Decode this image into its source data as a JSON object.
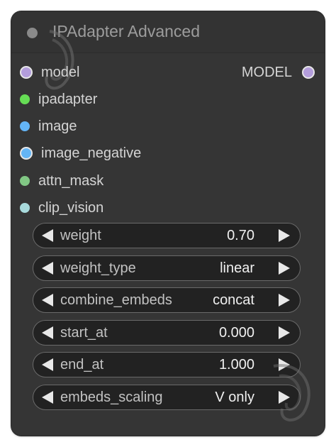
{
  "node": {
    "title": "IPAdapter Advanced",
    "inputs": [
      {
        "label": "model",
        "color": "#b39ddb",
        "ring": true
      },
      {
        "label": "ipadapter",
        "color": "#66dd55",
        "ring": false
      },
      {
        "label": "image",
        "color": "#64b5f6",
        "ring": false
      },
      {
        "label": "image_negative",
        "color": "#64b5f6",
        "ring": true
      },
      {
        "label": "attn_mask",
        "color": "#81c784",
        "ring": false
      },
      {
        "label": "clip_vision",
        "color": "#a8dadc",
        "ring": false
      }
    ],
    "outputs": [
      {
        "label": "MODEL",
        "color": "#b39ddb",
        "ring": true
      }
    ],
    "widgets": [
      {
        "label": "weight",
        "value": "0.70"
      },
      {
        "label": "weight_type",
        "value": "linear"
      },
      {
        "label": "combine_embeds",
        "value": "concat"
      },
      {
        "label": "start_at",
        "value": "0.000"
      },
      {
        "label": "end_at",
        "value": "1.000"
      },
      {
        "label": "embeds_scaling",
        "value": "V only"
      }
    ]
  }
}
